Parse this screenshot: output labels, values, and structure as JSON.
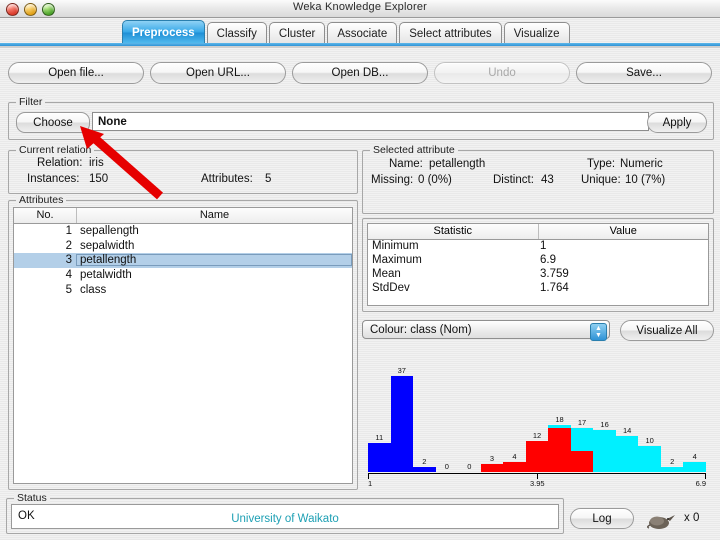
{
  "window": {
    "title": "Weka Knowledge Explorer"
  },
  "tabs": [
    {
      "label": "Preprocess",
      "active": true
    },
    {
      "label": "Classify",
      "active": false
    },
    {
      "label": "Cluster",
      "active": false
    },
    {
      "label": "Associate",
      "active": false
    },
    {
      "label": "Select attributes",
      "active": false
    },
    {
      "label": "Visualize",
      "active": false
    }
  ],
  "toolbar": {
    "open_file": "Open file...",
    "open_url": "Open URL...",
    "open_db": "Open DB...",
    "undo": "Undo",
    "save": "Save..."
  },
  "filter": {
    "legend": "Filter",
    "choose_label": "Choose",
    "value": "None",
    "apply_label": "Apply"
  },
  "current_relation": {
    "legend": "Current relation",
    "relation_label": "Relation:",
    "relation_value": "iris",
    "instances_label": "Instances:",
    "instances_value": "150",
    "attributes_label": "Attributes:",
    "attributes_value": "5"
  },
  "attributes": {
    "legend": "Attributes",
    "col_no": "No.",
    "col_name": "Name",
    "rows": [
      {
        "no": "1",
        "name": "sepallength",
        "selected": false
      },
      {
        "no": "2",
        "name": "sepalwidth",
        "selected": false
      },
      {
        "no": "3",
        "name": "petallength",
        "selected": true
      },
      {
        "no": "4",
        "name": "petalwidth",
        "selected": false
      },
      {
        "no": "5",
        "name": "class",
        "selected": false
      }
    ]
  },
  "selected_attribute": {
    "legend": "Selected attribute",
    "name_label": "Name:",
    "name_value": "petallength",
    "type_label": "Type:",
    "type_value": "Numeric",
    "missing_label": "Missing:",
    "missing_value": "0 (0%)",
    "distinct_label": "Distinct:",
    "distinct_value": "43",
    "unique_label": "Unique:",
    "unique_value": "10 (7%)"
  },
  "statistics": {
    "col_statistic": "Statistic",
    "col_value": "Value",
    "rows": [
      {
        "statistic": "Minimum",
        "value": "1"
      },
      {
        "statistic": "Maximum",
        "value": "6.9"
      },
      {
        "statistic": "Mean",
        "value": "3.759"
      },
      {
        "statistic": "StdDev",
        "value": "1.764"
      }
    ]
  },
  "colour": {
    "selected": "Colour: class (Nom)",
    "visualize_all": "Visualize All"
  },
  "chart_data": {
    "type": "bar",
    "title": "petallength histogram",
    "xlabel": "",
    "ylabel": "",
    "axis_ticks": [
      "1",
      "3.95",
      "6.9"
    ],
    "ylim": [
      0,
      37
    ],
    "grid": false,
    "legend": "none",
    "colors": {
      "class1": "#0000ff",
      "class2": "#ff0000",
      "class3": "#00f0ff"
    },
    "categories": [
      "1",
      "2",
      "3",
      "4",
      "5",
      "6",
      "7",
      "8",
      "9",
      "10",
      "11",
      "12",
      "13",
      "14",
      "15"
    ],
    "values": [
      11,
      37,
      2,
      0,
      0,
      3,
      4,
      12,
      18,
      17,
      16,
      14,
      10,
      2,
      4
    ],
    "bar_colors": [
      "#0000ff",
      "#0000ff",
      "#0000ff",
      "none",
      "none",
      "#ff0000",
      "#ff0000",
      "#ff0000",
      "#ff0000",
      "#ff0000",
      "#00f0ff",
      "#00f0ff",
      "#00f0ff",
      "#00f0ff",
      "#00f0ff"
    ],
    "cap_colors": [
      "none",
      "none",
      "none",
      "none",
      "none",
      "none",
      "none",
      "none",
      "#00f0ff",
      "#00f0ff",
      "none",
      "none",
      "none",
      "none",
      "none"
    ],
    "cap_values": [
      0,
      0,
      0,
      0,
      0,
      0,
      0,
      0,
      1,
      9,
      0,
      0,
      0,
      0,
      0
    ]
  },
  "status": {
    "legend": "Status",
    "text": "OK",
    "credit": "University of Waikato",
    "log_label": "Log",
    "bird_count": "x 0"
  }
}
